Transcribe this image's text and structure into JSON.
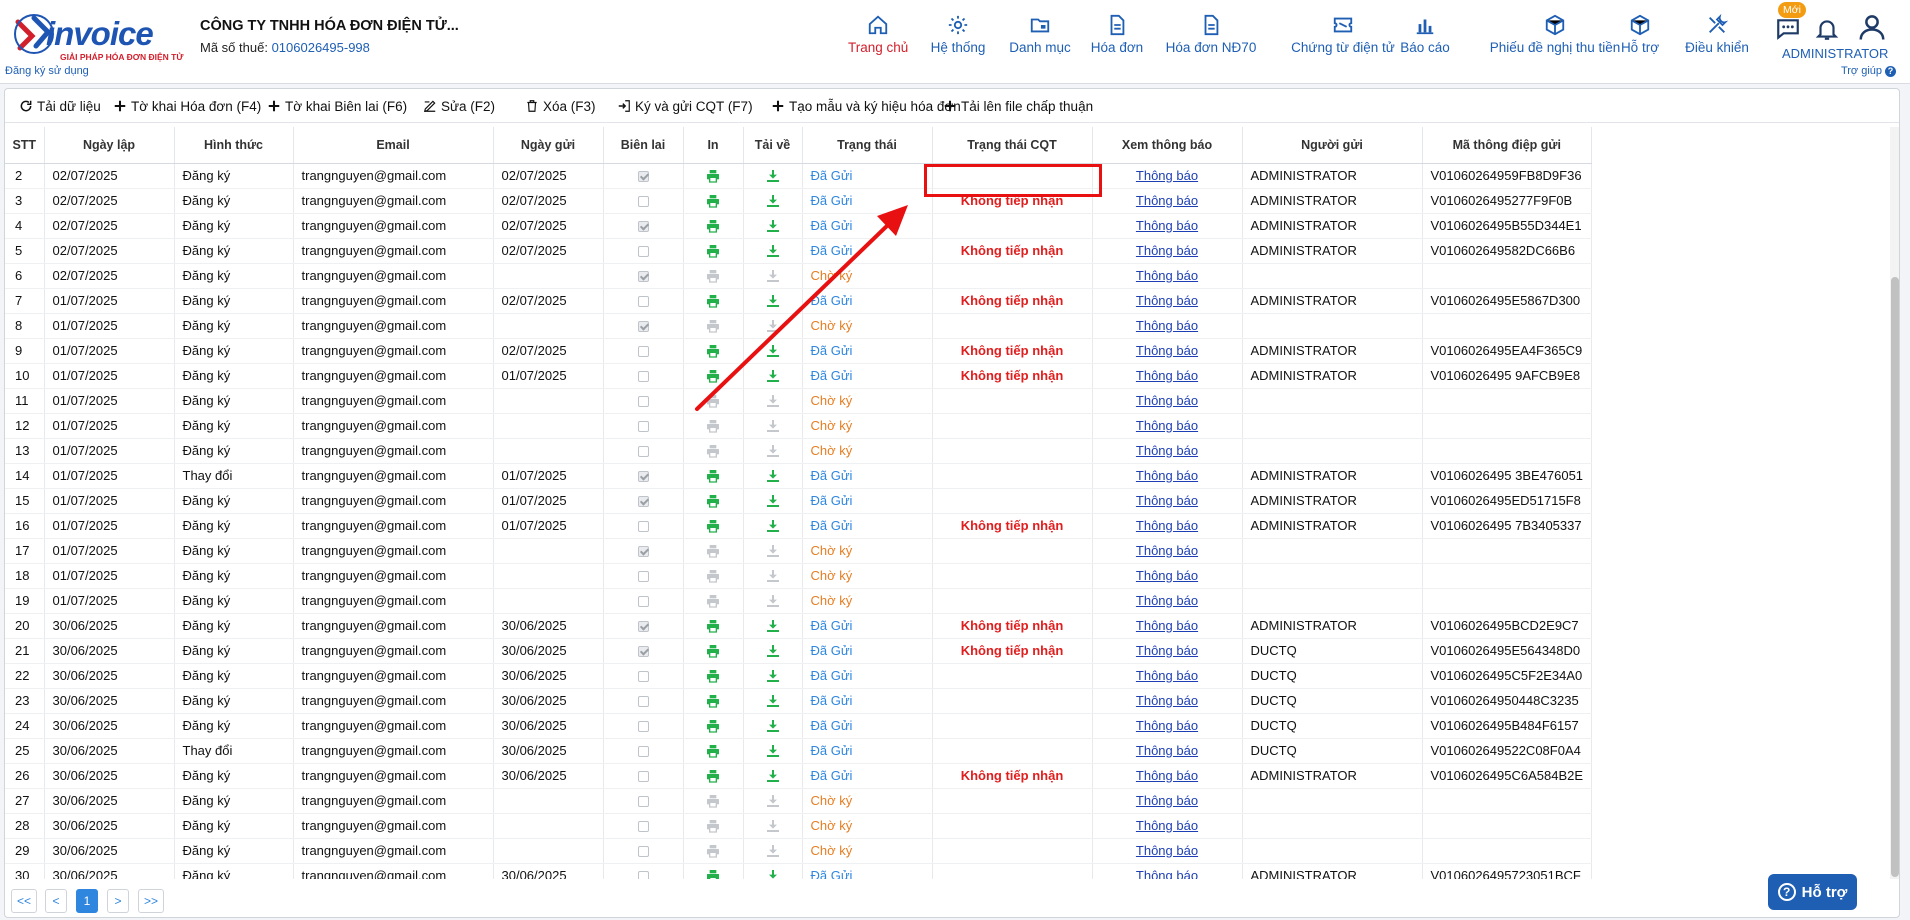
{
  "brand": {
    "word": "invoice",
    "tagline": "GIẢI PHÁP HÓA ĐƠN ĐIỆN TỬ",
    "color": "#1e55b3",
    "accent": "#d21f2b"
  },
  "company": {
    "name": "CÔNG TY TNHH HÓA ĐƠN ĐIỆN TỬ...",
    "tax_label": "Mã số thuế:",
    "tax_value": "0106026495-998"
  },
  "register_link": "Đăng ký sử dụng",
  "help_link": "Trợ giúp",
  "nav": [
    {
      "label": "Trang chủ",
      "icon": "home-icon",
      "active": true
    },
    {
      "label": "Hệ thống",
      "icon": "gear-icon"
    },
    {
      "label": "Danh mục",
      "icon": "folder-icon"
    },
    {
      "label": "Hóa đơn",
      "icon": "document-icon"
    },
    {
      "label": "Hóa đơn NĐ70",
      "icon": "document-icon"
    },
    {
      "label": "Chứng từ điện tử",
      "icon": "ticket-icon"
    },
    {
      "label": "Báo cáo",
      "icon": "bar-chart-icon"
    },
    {
      "label": "Phiếu đề nghị thu tiền",
      "icon": "box-icon"
    },
    {
      "label": "Hỗ trợ",
      "icon": "box-icon"
    },
    {
      "label": "Điều khiển",
      "icon": "tools-icon"
    }
  ],
  "user": {
    "new_badge": "Mới",
    "name": "ADMINISTRATOR"
  },
  "toolbar": [
    {
      "label": "Tải dữ liệu",
      "icon": "refresh-icon"
    },
    {
      "label": "Tờ khai Hóa đơn (F4)",
      "icon": "plus-icon"
    },
    {
      "label": "Tờ khai Biên lai (F6)",
      "icon": "plus-icon"
    },
    {
      "label": "Sửa (F2)",
      "icon": "edit-icon"
    },
    {
      "label": "Xóa (F3)",
      "icon": "trash-icon"
    },
    {
      "label": "Ký và gửi CQT (F7)",
      "icon": "sign-in-icon"
    },
    {
      "label": "Tạo mẫu và ký hiệu hóa đơn",
      "icon": "plus-icon"
    },
    {
      "label": "Tải lên file chấp thuận",
      "icon": "plus-icon"
    }
  ],
  "columns": [
    "STT",
    "Ngày lập",
    "Hình thức",
    "Email",
    "Ngày gửi",
    "Biên lai",
    "In",
    "Tải về",
    "Trạng thái",
    "Trạng thái CQT",
    "Xem thông báo",
    "Người gửi",
    "Mã thông điệp gửi"
  ],
  "rows": [
    {
      "stt": "2",
      "date": "02/07/2025",
      "type": "Đăng ký",
      "email": "trangnguyen@gmail.com",
      "sent": "02/07/2025",
      "receipt": true,
      "status": "Đã Gửi",
      "cqt": "",
      "notice": "Thông báo",
      "sender": "ADMINISTRATOR",
      "msg": "V01060264959FB8D9F36"
    },
    {
      "stt": "3",
      "date": "02/07/2025",
      "type": "Đăng ký",
      "email": "trangnguyen@gmail.com",
      "sent": "02/07/2025",
      "receipt": false,
      "status": "Đã Gửi",
      "cqt": "Không tiếp nhận",
      "notice": "Thông báo",
      "sender": "ADMINISTRATOR",
      "msg": "V0106026495277F9F0B"
    },
    {
      "stt": "4",
      "date": "02/07/2025",
      "type": "Đăng ký",
      "email": "trangnguyen@gmail.com",
      "sent": "02/07/2025",
      "receipt": true,
      "status": "Đã Gửi",
      "cqt": "",
      "notice": "Thông báo",
      "sender": "ADMINISTRATOR",
      "msg": "V0106026495B55D344E1"
    },
    {
      "stt": "5",
      "date": "02/07/2025",
      "type": "Đăng ký",
      "email": "trangnguyen@gmail.com",
      "sent": "02/07/2025",
      "receipt": false,
      "status": "Đã Gửi",
      "cqt": "Không tiếp nhận",
      "notice": "Thông báo",
      "sender": "ADMINISTRATOR",
      "msg": "V010602649582DC66B6"
    },
    {
      "stt": "6",
      "date": "02/07/2025",
      "type": "Đăng ký",
      "email": "trangnguyen@gmail.com",
      "sent": "",
      "receipt": true,
      "status": "Chờ ký",
      "cqt": "",
      "notice": "Thông báo",
      "sender": "",
      "msg": ""
    },
    {
      "stt": "7",
      "date": "01/07/2025",
      "type": "Đăng ký",
      "email": "trangnguyen@gmail.com",
      "sent": "02/07/2025",
      "receipt": false,
      "status": "Đã Gửi",
      "cqt": "Không tiếp nhận",
      "notice": "Thông báo",
      "sender": "ADMINISTRATOR",
      "msg": "V0106026495E5867D300"
    },
    {
      "stt": "8",
      "date": "01/07/2025",
      "type": "Đăng ký",
      "email": "trangnguyen@gmail.com",
      "sent": "",
      "receipt": true,
      "status": "Chờ ký",
      "cqt": "",
      "notice": "Thông báo",
      "sender": "",
      "msg": ""
    },
    {
      "stt": "9",
      "date": "01/07/2025",
      "type": "Đăng ký",
      "email": "trangnguyen@gmail.com",
      "sent": "02/07/2025",
      "receipt": false,
      "status": "Đã Gửi",
      "cqt": "Không tiếp nhận",
      "notice": "Thông báo",
      "sender": "ADMINISTRATOR",
      "msg": "V0106026495EA4F365C9"
    },
    {
      "stt": "10",
      "date": "01/07/2025",
      "type": "Đăng ký",
      "email": "trangnguyen@gmail.com",
      "sent": "01/07/2025",
      "receipt": false,
      "status": "Đã Gửi",
      "cqt": "Không tiếp nhận",
      "notice": "Thông báo",
      "sender": "ADMINISTRATOR",
      "msg": "V0106026495 9AFCB9E8"
    },
    {
      "stt": "11",
      "date": "01/07/2025",
      "type": "Đăng ký",
      "email": "trangnguyen@gmail.com",
      "sent": "",
      "receipt": false,
      "status": "Chờ ký",
      "cqt": "",
      "notice": "Thông báo",
      "sender": "",
      "msg": ""
    },
    {
      "stt": "12",
      "date": "01/07/2025",
      "type": "Đăng ký",
      "email": "trangnguyen@gmail.com",
      "sent": "",
      "receipt": false,
      "status": "Chờ ký",
      "cqt": "",
      "notice": "Thông báo",
      "sender": "",
      "msg": ""
    },
    {
      "stt": "13",
      "date": "01/07/2025",
      "type": "Đăng ký",
      "email": "trangnguyen@gmail.com",
      "sent": "",
      "receipt": false,
      "status": "Chờ ký",
      "cqt": "",
      "notice": "Thông báo",
      "sender": "",
      "msg": ""
    },
    {
      "stt": "14",
      "date": "01/07/2025",
      "type": "Thay đổi",
      "email": "trangnguyen@gmail.com",
      "sent": "01/07/2025",
      "receipt": true,
      "status": "Đã Gửi",
      "cqt": "",
      "notice": "Thông báo",
      "sender": "ADMINISTRATOR",
      "msg": "V0106026495 3BE476051"
    },
    {
      "stt": "15",
      "date": "01/07/2025",
      "type": "Đăng ký",
      "email": "trangnguyen@gmail.com",
      "sent": "01/07/2025",
      "receipt": true,
      "status": "Đã Gửi",
      "cqt": "",
      "notice": "Thông báo",
      "sender": "ADMINISTRATOR",
      "msg": "V0106026495ED51715F8"
    },
    {
      "stt": "16",
      "date": "01/07/2025",
      "type": "Đăng ký",
      "email": "trangnguyen@gmail.com",
      "sent": "01/07/2025",
      "receipt": false,
      "status": "Đã Gửi",
      "cqt": "Không tiếp nhận",
      "notice": "Thông báo",
      "sender": "ADMINISTRATOR",
      "msg": "V0106026495 7B3405337"
    },
    {
      "stt": "17",
      "date": "01/07/2025",
      "type": "Đăng ký",
      "email": "trangnguyen@gmail.com",
      "sent": "",
      "receipt": true,
      "status": "Chờ ký",
      "cqt": "",
      "notice": "Thông báo",
      "sender": "",
      "msg": ""
    },
    {
      "stt": "18",
      "date": "01/07/2025",
      "type": "Đăng ký",
      "email": "trangnguyen@gmail.com",
      "sent": "",
      "receipt": false,
      "status": "Chờ ký",
      "cqt": "",
      "notice": "Thông báo",
      "sender": "",
      "msg": ""
    },
    {
      "stt": "19",
      "date": "01/07/2025",
      "type": "Đăng ký",
      "email": "trangnguyen@gmail.com",
      "sent": "",
      "receipt": false,
      "status": "Chờ ký",
      "cqt": "",
      "notice": "Thông báo",
      "sender": "",
      "msg": ""
    },
    {
      "stt": "20",
      "date": "30/06/2025",
      "type": "Đăng ký",
      "email": "trangnguyen@gmail.com",
      "sent": "30/06/2025",
      "receipt": true,
      "status": "Đã Gửi",
      "cqt": "Không tiếp nhận",
      "notice": "Thông báo",
      "sender": "ADMINISTRATOR",
      "msg": "V0106026495BCD2E9C7"
    },
    {
      "stt": "21",
      "date": "30/06/2025",
      "type": "Đăng ký",
      "email": "trangnguyen@gmail.com",
      "sent": "30/06/2025",
      "receipt": true,
      "status": "Đã Gửi",
      "cqt": "Không tiếp nhận",
      "notice": "Thông báo",
      "sender": "DUCTQ",
      "msg": "V0106026495E564348D0"
    },
    {
      "stt": "22",
      "date": "30/06/2025",
      "type": "Đăng ký",
      "email": "trangnguyen@gmail.com",
      "sent": "30/06/2025",
      "receipt": false,
      "status": "Đã Gửi",
      "cqt": "",
      "notice": "Thông báo",
      "sender": "DUCTQ",
      "msg": "V0106026495C5F2E34A0"
    },
    {
      "stt": "23",
      "date": "30/06/2025",
      "type": "Đăng ký",
      "email": "trangnguyen@gmail.com",
      "sent": "30/06/2025",
      "receipt": false,
      "status": "Đã Gửi",
      "cqt": "",
      "notice": "Thông báo",
      "sender": "DUCTQ",
      "msg": "V01060264950448C3235"
    },
    {
      "stt": "24",
      "date": "30/06/2025",
      "type": "Đăng ký",
      "email": "trangnguyen@gmail.com",
      "sent": "30/06/2025",
      "receipt": false,
      "status": "Đã Gửi",
      "cqt": "",
      "notice": "Thông báo",
      "sender": "DUCTQ",
      "msg": "V0106026495B484F6157"
    },
    {
      "stt": "25",
      "date": "30/06/2025",
      "type": "Thay đổi",
      "email": "trangnguyen@gmail.com",
      "sent": "30/06/2025",
      "receipt": false,
      "status": "Đã Gửi",
      "cqt": "",
      "notice": "Thông báo",
      "sender": "DUCTQ",
      "msg": "V010602649522C08F0A4"
    },
    {
      "stt": "26",
      "date": "30/06/2025",
      "type": "Đăng ký",
      "email": "trangnguyen@gmail.com",
      "sent": "30/06/2025",
      "receipt": false,
      "status": "Đã Gửi",
      "cqt": "Không tiếp nhận",
      "notice": "Thông báo",
      "sender": "ADMINISTRATOR",
      "msg": "V0106026495C6A584B2E"
    },
    {
      "stt": "27",
      "date": "30/06/2025",
      "type": "Đăng ký",
      "email": "trangnguyen@gmail.com",
      "sent": "",
      "receipt": false,
      "status": "Chờ ký",
      "cqt": "",
      "notice": "Thông báo",
      "sender": "",
      "msg": ""
    },
    {
      "stt": "28",
      "date": "30/06/2025",
      "type": "Đăng ký",
      "email": "trangnguyen@gmail.com",
      "sent": "",
      "receipt": false,
      "status": "Chờ ký",
      "cqt": "",
      "notice": "Thông báo",
      "sender": "",
      "msg": ""
    },
    {
      "stt": "29",
      "date": "30/06/2025",
      "type": "Đăng ký",
      "email": "trangnguyen@gmail.com",
      "sent": "",
      "receipt": false,
      "status": "Chờ ký",
      "cqt": "",
      "notice": "Thông báo",
      "sender": "",
      "msg": ""
    },
    {
      "stt": "30",
      "date": "30/06/2025",
      "type": "Đăng ký",
      "email": "trangnguyen@gmail.com",
      "sent": "30/06/2025",
      "receipt": false,
      "status": "Đã Gửi",
      "cqt": "",
      "notice": "Thông báo",
      "sender": "ADMINISTRATOR",
      "msg": "V0106026495723051BCF"
    }
  ],
  "pager": {
    "first": "<<",
    "prev": "<",
    "current": "1",
    "next": ">",
    "last": ">>"
  },
  "support_button": "Hỗ trợ",
  "colors": {
    "sent": "#2e86de",
    "waiting": "#e67e22",
    "rejected": "#e21d1d",
    "print_active": "#22b04b",
    "annotation": "#e81010"
  }
}
